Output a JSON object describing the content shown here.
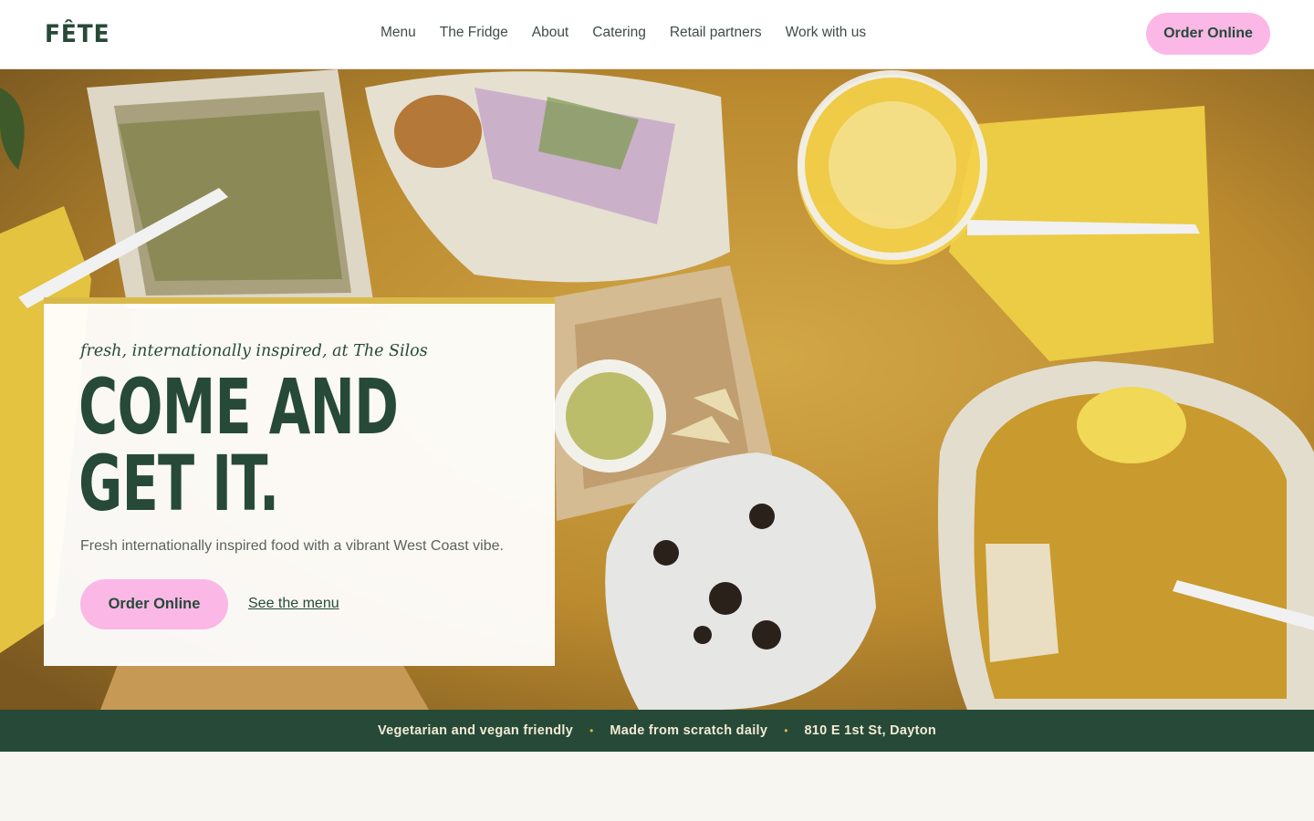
{
  "brand": {
    "logo": "FÊTE"
  },
  "nav": {
    "items": [
      "Menu",
      "The Fridge",
      "About",
      "Catering",
      "Retail partners",
      "Work with us"
    ],
    "cta": "Order Online"
  },
  "hero": {
    "tagline": "fresh, internationally inspired, at The Silos",
    "headline_line1": "COME AND",
    "headline_line2": "GET IT.",
    "subtext": "Fresh internationally inspired food with a vibrant West Coast vibe.",
    "primary_cta": "Order Online",
    "secondary_cta": "See the menu",
    "image_icon": "food-table-photo"
  },
  "banner": {
    "items": [
      "Vegetarian and vegan friendly",
      "Made from scratch daily",
      "810 E 1st St, Dayton"
    ],
    "separator": "•"
  },
  "colors": {
    "brand_green": "#264a37",
    "pink": "#fbb7e6",
    "accent_yellow": "#d9b94a",
    "background": "#f8f6f1"
  }
}
